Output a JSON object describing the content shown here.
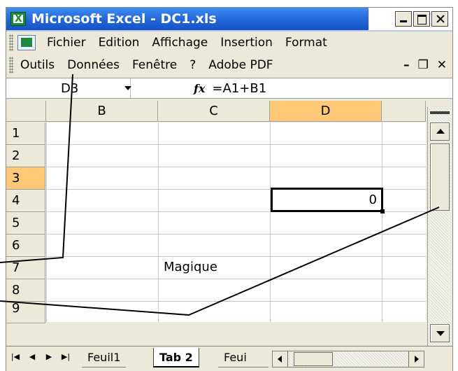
{
  "window": {
    "title": "Microsoft Excel - DC1.xls"
  },
  "menu": {
    "row1": [
      "Fichier",
      "Edition",
      "Affichage",
      "Insertion",
      "Format"
    ],
    "row2": [
      "Outils",
      "Données",
      "Fenêtre",
      "?",
      "Adobe PDF"
    ],
    "doc_controls": [
      "_",
      "\u0002",
      "×"
    ]
  },
  "formula_bar": {
    "name_box": "D3",
    "fx": "fx",
    "formula": "=A1+B1"
  },
  "grid": {
    "columns": [
      "B",
      "C",
      "D"
    ],
    "rows": [
      "1",
      "2",
      "3",
      "4",
      "5",
      "6",
      "7",
      "8",
      "9"
    ],
    "selected_cell": "D3",
    "cells": {
      "D3": "0",
      "C6": "Magique"
    }
  },
  "tabs": {
    "nav_labels": [
      "|◀",
      "◀",
      "▶",
      "▶|"
    ],
    "sheets": [
      "Feuil1",
      "Tab 2",
      "Feui"
    ],
    "active": "Tab 2"
  },
  "colors": {
    "title_bar": "#2468d9",
    "selection_header": "#ffc876",
    "chrome": "#ece9d8"
  }
}
